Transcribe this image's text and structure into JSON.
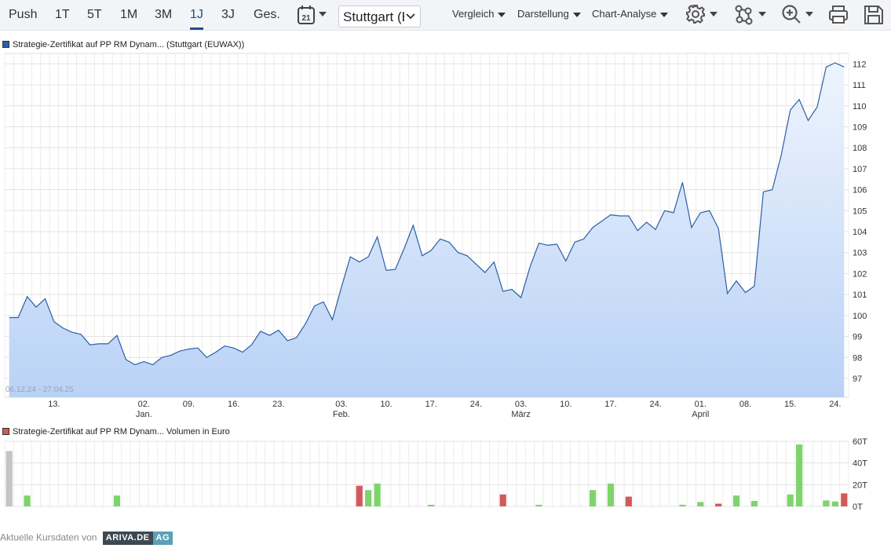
{
  "toolbar": {
    "ranges": [
      "Push",
      "1T",
      "5T",
      "1M",
      "3M",
      "1J",
      "3J",
      "Ges."
    ],
    "active_range": "1J",
    "exchange_select": "Stuttgart (EUWAX)",
    "menus": [
      "Vergleich",
      "Darstellung",
      "Chart-Analyse"
    ],
    "calendar_day": "21",
    "icons": [
      "calendar-icon",
      "gear-icon",
      "indicator-network-icon",
      "zoom-in-icon",
      "print-icon",
      "save-icon"
    ]
  },
  "price_chart": {
    "legend": "Strategie-Zertifikat auf PP RM Dynam... (Stuttgart (EUWAX))",
    "date_range": "06.12.24 - 27.04.25",
    "color_line": "#2b5fa6",
    "color_fill_top": "#eef4fd",
    "color_fill_bottom": "#b9d2f6"
  },
  "volume_chart": {
    "legend": "Strategie-Zertifikat auf PP RM Dynam... Volumen in Euro",
    "color_up": "#7ed46b",
    "color_down": "#d25a5a",
    "color_neutral": "#c4c4c4"
  },
  "footer": {
    "text": "Aktuelle Kursdaten von",
    "logo_part1": "ARIVA.DE",
    "logo_part2": "AG"
  },
  "chart_data": [
    {
      "type": "area",
      "title": "Strategie-Zertifikat auf PP RM Dynam... (Stuttgart (EUWAX))",
      "ylim": [
        96.1,
        112.5
      ],
      "yticks": [
        97,
        98,
        99,
        100,
        101,
        102,
        103,
        104,
        105,
        106,
        107,
        108,
        109,
        110,
        111,
        112
      ],
      "xticks": [
        {
          "i": 5,
          "label": "13."
        },
        {
          "i": 15,
          "label": "02.",
          "sub": "Jan."
        },
        {
          "i": 20,
          "label": "09."
        },
        {
          "i": 25,
          "label": "16."
        },
        {
          "i": 30,
          "label": "23."
        },
        {
          "i": 37,
          "label": "03.",
          "sub": "Feb."
        },
        {
          "i": 42,
          "label": "10."
        },
        {
          "i": 47,
          "label": "17."
        },
        {
          "i": 52,
          "label": "24."
        },
        {
          "i": 57,
          "label": "03.",
          "sub": "März"
        },
        {
          "i": 62,
          "label": "10."
        },
        {
          "i": 67,
          "label": "17."
        },
        {
          "i": 72,
          "label": "24."
        },
        {
          "i": 77,
          "label": "01.",
          "sub": "April"
        },
        {
          "i": 82,
          "label": "08."
        },
        {
          "i": 87,
          "label": "15."
        },
        {
          "i": 92,
          "label": "24."
        }
      ],
      "n_slots": 94,
      "values": [
        99.9,
        99.9,
        100.9,
        100.4,
        100.8,
        99.7,
        99.4,
        99.2,
        99.1,
        98.6,
        98.65,
        98.65,
        99.05,
        97.9,
        97.65,
        97.8,
        97.65,
        98.0,
        98.1,
        98.3,
        98.4,
        98.45,
        98.0,
        98.25,
        98.55,
        98.45,
        98.25,
        98.6,
        99.25,
        99.05,
        99.3,
        98.8,
        98.95,
        99.6,
        100.45,
        100.65,
        99.8,
        101.35,
        102.8,
        102.55,
        102.8,
        103.75,
        102.15,
        102.2,
        103.2,
        104.3,
        102.85,
        103.1,
        103.65,
        103.5,
        103.0,
        102.85,
        102.45,
        102.05,
        102.55,
        101.15,
        101.25,
        100.85,
        102.3,
        103.45,
        103.35,
        103.4,
        102.6,
        103.5,
        103.65,
        104.2,
        104.5,
        104.8,
        104.75,
        104.75,
        104.05,
        104.45,
        104.1,
        105.0,
        104.9,
        106.35,
        104.2,
        104.9,
        105.0,
        104.15,
        101.05,
        101.65,
        101.1,
        101.4,
        105.9,
        106.0,
        107.65,
        109.8,
        110.3,
        109.3,
        109.95,
        111.85,
        112.05,
        111.85
      ]
    },
    {
      "type": "bar",
      "title": "Strategie-Zertifikat auf PP RM Dynam... Volumen in Euro",
      "ylim": [
        0,
        60
      ],
      "yticks": [
        {
          "v": 0,
          "label": "0T"
        },
        {
          "v": 20,
          "label": "20T"
        },
        {
          "v": 40,
          "label": "40T"
        },
        {
          "v": 60,
          "label": "60T"
        }
      ],
      "bars": [
        {
          "i": 0,
          "v": 51,
          "dir": "neutral"
        },
        {
          "i": 2,
          "v": 10,
          "dir": "up"
        },
        {
          "i": 12,
          "v": 10,
          "dir": "up"
        },
        {
          "i": 39,
          "v": 19,
          "dir": "down"
        },
        {
          "i": 40,
          "v": 15,
          "dir": "up"
        },
        {
          "i": 41,
          "v": 21,
          "dir": "up"
        },
        {
          "i": 47,
          "v": 1.5,
          "dir": "up"
        },
        {
          "i": 55,
          "v": 11,
          "dir": "down"
        },
        {
          "i": 59,
          "v": 1.5,
          "dir": "up"
        },
        {
          "i": 65,
          "v": 15,
          "dir": "up"
        },
        {
          "i": 67,
          "v": 21,
          "dir": "up"
        },
        {
          "i": 69,
          "v": 9,
          "dir": "down"
        },
        {
          "i": 75,
          "v": 1.5,
          "dir": "up"
        },
        {
          "i": 77,
          "v": 4,
          "dir": "up"
        },
        {
          "i": 79,
          "v": 2.5,
          "dir": "down"
        },
        {
          "i": 81,
          "v": 10,
          "dir": "up"
        },
        {
          "i": 83,
          "v": 5,
          "dir": "up"
        },
        {
          "i": 87,
          "v": 11,
          "dir": "up"
        },
        {
          "i": 88,
          "v": 57,
          "dir": "up"
        },
        {
          "i": 91,
          "v": 5.5,
          "dir": "up"
        },
        {
          "i": 92,
          "v": 4.5,
          "dir": "up"
        },
        {
          "i": 93,
          "v": 12,
          "dir": "down"
        }
      ]
    }
  ]
}
